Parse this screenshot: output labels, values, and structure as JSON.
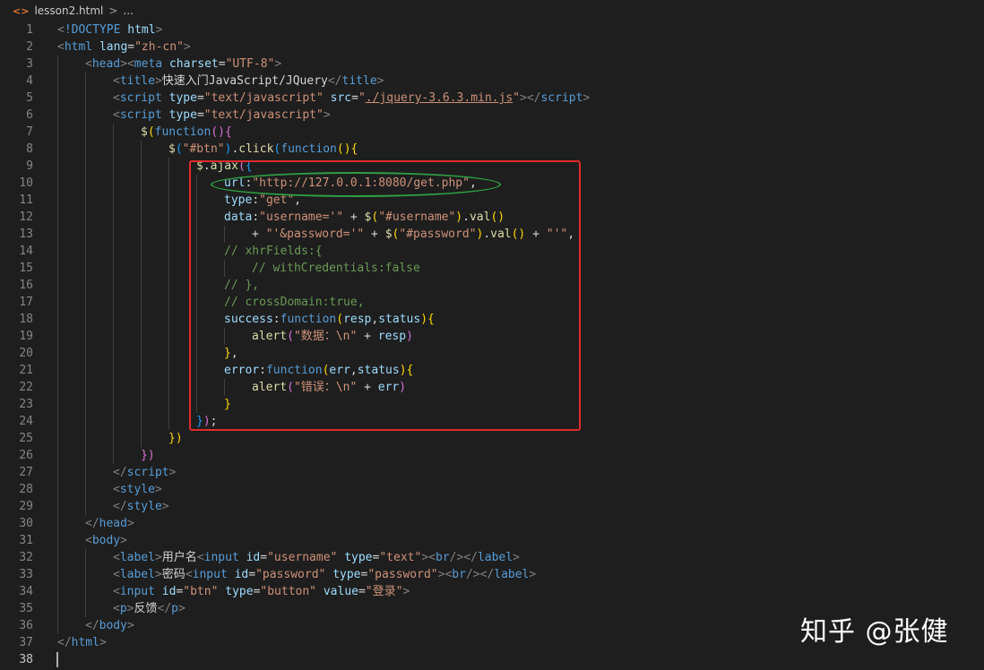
{
  "breadcrumb": {
    "icon": "html-file-icon",
    "file": "lesson2.html",
    "separator": ">",
    "symbol": "..."
  },
  "annotations": {
    "red_box": "highlight-ajax-block",
    "green_ellipse": "highlight-url-line"
  },
  "watermark": "知乎 @张健",
  "colors": {
    "background": "#1e1e1e",
    "red_box": "#e02b2b",
    "green_ellipse": "#2ea043",
    "line_number": "#858585"
  },
  "code_lines": [
    {
      "n": "1",
      "indent": 0,
      "tokens": [
        {
          "t": "<",
          "c": "br"
        },
        {
          "t": "!DOCTYPE",
          "c": "tag"
        },
        {
          "t": " html",
          "c": "attr"
        },
        {
          "t": ">",
          "c": "br"
        }
      ]
    },
    {
      "n": "2",
      "indent": 0,
      "tokens": [
        {
          "t": "<",
          "c": "br"
        },
        {
          "t": "html",
          "c": "tag"
        },
        {
          "t": " lang",
          "c": "attr"
        },
        {
          "t": "=",
          "c": "txt"
        },
        {
          "t": "\"zh-cn\"",
          "c": "str"
        },
        {
          "t": ">",
          "c": "br"
        }
      ]
    },
    {
      "n": "3",
      "indent": 1,
      "tokens": [
        {
          "t": "<",
          "c": "br"
        },
        {
          "t": "head",
          "c": "tag"
        },
        {
          "t": "><",
          "c": "br"
        },
        {
          "t": "meta",
          "c": "tag"
        },
        {
          "t": " charset",
          "c": "attr"
        },
        {
          "t": "=",
          "c": "txt"
        },
        {
          "t": "\"UTF-8\"",
          "c": "str"
        },
        {
          "t": ">",
          "c": "br"
        }
      ]
    },
    {
      "n": "4",
      "indent": 2,
      "tokens": [
        {
          "t": "<",
          "c": "br"
        },
        {
          "t": "title",
          "c": "tag"
        },
        {
          "t": ">",
          "c": "br"
        },
        {
          "t": "快速入门JavaScript/JQuery",
          "c": "txt"
        },
        {
          "t": "</",
          "c": "br"
        },
        {
          "t": "title",
          "c": "tag"
        },
        {
          "t": ">",
          "c": "br"
        }
      ]
    },
    {
      "n": "5",
      "indent": 2,
      "tokens": [
        {
          "t": "<",
          "c": "br"
        },
        {
          "t": "script",
          "c": "tag"
        },
        {
          "t": " type",
          "c": "attr"
        },
        {
          "t": "=",
          "c": "txt"
        },
        {
          "t": "\"text/javascript\"",
          "c": "str"
        },
        {
          "t": " src",
          "c": "attr"
        },
        {
          "t": "=",
          "c": "txt"
        },
        {
          "t": "\"",
          "c": "str"
        },
        {
          "t": "./jquery-3.6.3.min.js",
          "c": "link"
        },
        {
          "t": "\"",
          "c": "str"
        },
        {
          "t": "></",
          "c": "br"
        },
        {
          "t": "script",
          "c": "tag"
        },
        {
          "t": ">",
          "c": "br"
        }
      ]
    },
    {
      "n": "6",
      "indent": 2,
      "tokens": [
        {
          "t": "<",
          "c": "br"
        },
        {
          "t": "script",
          "c": "tag"
        },
        {
          "t": " type",
          "c": "attr"
        },
        {
          "t": "=",
          "c": "txt"
        },
        {
          "t": "\"text/javascript\"",
          "c": "str"
        },
        {
          "t": ">",
          "c": "br"
        }
      ]
    },
    {
      "n": "7",
      "indent": 3,
      "tokens": [
        {
          "t": "$",
          "c": "fn"
        },
        {
          "t": "(",
          "c": "b1"
        },
        {
          "t": "function",
          "c": "kw"
        },
        {
          "t": "()",
          "c": "b2"
        },
        {
          "t": "{",
          "c": "b2"
        }
      ]
    },
    {
      "n": "8",
      "indent": 4,
      "tokens": [
        {
          "t": "$",
          "c": "fn"
        },
        {
          "t": "(",
          "c": "b3"
        },
        {
          "t": "\"#btn\"",
          "c": "str"
        },
        {
          "t": ")",
          "c": "b3"
        },
        {
          "t": ".",
          "c": "txt"
        },
        {
          "t": "click",
          "c": "fn"
        },
        {
          "t": "(",
          "c": "b3"
        },
        {
          "t": "function",
          "c": "kw"
        },
        {
          "t": "()",
          "c": "b1"
        },
        {
          "t": "{",
          "c": "b1"
        }
      ]
    },
    {
      "n": "9",
      "indent": 5,
      "tokens": [
        {
          "t": "$",
          "c": "fn"
        },
        {
          "t": ".",
          "c": "txt"
        },
        {
          "t": "ajax",
          "c": "fn"
        },
        {
          "t": "(",
          "c": "b2"
        },
        {
          "t": "{",
          "c": "b3"
        }
      ]
    },
    {
      "n": "10",
      "indent": 6,
      "tokens": [
        {
          "t": "url",
          "c": "attr"
        },
        {
          "t": ":",
          "c": "txt"
        },
        {
          "t": "\"http://127.0.0.1:8080/get.php\"",
          "c": "str"
        },
        {
          "t": ",",
          "c": "txt"
        }
      ]
    },
    {
      "n": "11",
      "indent": 6,
      "tokens": [
        {
          "t": "type",
          "c": "attr"
        },
        {
          "t": ":",
          "c": "txt"
        },
        {
          "t": "\"get\"",
          "c": "str"
        },
        {
          "t": ",",
          "c": "txt"
        }
      ]
    },
    {
      "n": "12",
      "indent": 6,
      "tokens": [
        {
          "t": "data",
          "c": "attr"
        },
        {
          "t": ":",
          "c": "txt"
        },
        {
          "t": "\"username='\"",
          "c": "str"
        },
        {
          "t": " + ",
          "c": "txt"
        },
        {
          "t": "$",
          "c": "fn"
        },
        {
          "t": "(",
          "c": "b1"
        },
        {
          "t": "\"#username\"",
          "c": "str"
        },
        {
          "t": ")",
          "c": "b1"
        },
        {
          "t": ".",
          "c": "txt"
        },
        {
          "t": "val",
          "c": "fn"
        },
        {
          "t": "()",
          "c": "b1"
        }
      ]
    },
    {
      "n": "13",
      "indent": 7,
      "tokens": [
        {
          "t": "+ ",
          "c": "txt"
        },
        {
          "t": "\"'&password='\"",
          "c": "str"
        },
        {
          "t": " + ",
          "c": "txt"
        },
        {
          "t": "$",
          "c": "fn"
        },
        {
          "t": "(",
          "c": "b1"
        },
        {
          "t": "\"#password\"",
          "c": "str"
        },
        {
          "t": ")",
          "c": "b1"
        },
        {
          "t": ".",
          "c": "txt"
        },
        {
          "t": "val",
          "c": "fn"
        },
        {
          "t": "()",
          "c": "b1"
        },
        {
          "t": " + ",
          "c": "txt"
        },
        {
          "t": "\"'\"",
          "c": "str"
        },
        {
          "t": ",",
          "c": "txt"
        }
      ]
    },
    {
      "n": "14",
      "indent": 6,
      "tokens": [
        {
          "t": "// xhrFields:{",
          "c": "com"
        }
      ]
    },
    {
      "n": "15",
      "indent": 7,
      "tokens": [
        {
          "t": "// withCredentials:false",
          "c": "com"
        }
      ]
    },
    {
      "n": "16",
      "indent": 6,
      "tokens": [
        {
          "t": "// },",
          "c": "com"
        }
      ]
    },
    {
      "n": "17",
      "indent": 6,
      "tokens": [
        {
          "t": "// crossDomain:true,",
          "c": "com"
        }
      ]
    },
    {
      "n": "18",
      "indent": 6,
      "tokens": [
        {
          "t": "success",
          "c": "attr"
        },
        {
          "t": ":",
          "c": "txt"
        },
        {
          "t": "function",
          "c": "kw"
        },
        {
          "t": "(",
          "c": "b1"
        },
        {
          "t": "resp",
          "c": "attr"
        },
        {
          "t": ",",
          "c": "txt"
        },
        {
          "t": "status",
          "c": "attr"
        },
        {
          "t": ")",
          "c": "b1"
        },
        {
          "t": "{",
          "c": "b1"
        }
      ]
    },
    {
      "n": "19",
      "indent": 7,
      "tokens": [
        {
          "t": "alert",
          "c": "fn"
        },
        {
          "t": "(",
          "c": "b2"
        },
        {
          "t": "\"数据：\\n\"",
          "c": "str"
        },
        {
          "t": " + ",
          "c": "txt"
        },
        {
          "t": "resp",
          "c": "attr"
        },
        {
          "t": ")",
          "c": "b2"
        }
      ]
    },
    {
      "n": "20",
      "indent": 6,
      "tokens": [
        {
          "t": "}",
          "c": "b1"
        },
        {
          "t": ",",
          "c": "txt"
        }
      ]
    },
    {
      "n": "21",
      "indent": 6,
      "tokens": [
        {
          "t": "error",
          "c": "attr"
        },
        {
          "t": ":",
          "c": "txt"
        },
        {
          "t": "function",
          "c": "kw"
        },
        {
          "t": "(",
          "c": "b1"
        },
        {
          "t": "err",
          "c": "attr"
        },
        {
          "t": ",",
          "c": "txt"
        },
        {
          "t": "status",
          "c": "attr"
        },
        {
          "t": ")",
          "c": "b1"
        },
        {
          "t": "{",
          "c": "b1"
        }
      ]
    },
    {
      "n": "22",
      "indent": 7,
      "tokens": [
        {
          "t": "alert",
          "c": "fn"
        },
        {
          "t": "(",
          "c": "b2"
        },
        {
          "t": "\"错误：\\n\"",
          "c": "str"
        },
        {
          "t": " + ",
          "c": "txt"
        },
        {
          "t": "err",
          "c": "attr"
        },
        {
          "t": ")",
          "c": "b2"
        }
      ]
    },
    {
      "n": "23",
      "indent": 6,
      "tokens": [
        {
          "t": "}",
          "c": "b1"
        }
      ]
    },
    {
      "n": "24",
      "indent": 5,
      "tokens": [
        {
          "t": "}",
          "c": "b3"
        },
        {
          "t": ")",
          "c": "b2"
        },
        {
          "t": ";",
          "c": "txt"
        }
      ]
    },
    {
      "n": "25",
      "indent": 4,
      "tokens": [
        {
          "t": "})",
          "c": "b1"
        }
      ]
    },
    {
      "n": "26",
      "indent": 3,
      "tokens": [
        {
          "t": "})",
          "c": "b2"
        }
      ]
    },
    {
      "n": "27",
      "indent": 2,
      "tokens": [
        {
          "t": "</",
          "c": "br"
        },
        {
          "t": "script",
          "c": "tag"
        },
        {
          "t": ">",
          "c": "br"
        }
      ]
    },
    {
      "n": "28",
      "indent": 2,
      "tokens": [
        {
          "t": "<",
          "c": "br"
        },
        {
          "t": "style",
          "c": "tag"
        },
        {
          "t": ">",
          "c": "br"
        }
      ]
    },
    {
      "n": "29",
      "indent": 2,
      "tokens": [
        {
          "t": "</",
          "c": "br"
        },
        {
          "t": "style",
          "c": "tag"
        },
        {
          "t": ">",
          "c": "br"
        }
      ]
    },
    {
      "n": "30",
      "indent": 1,
      "tokens": [
        {
          "t": "</",
          "c": "br"
        },
        {
          "t": "head",
          "c": "tag"
        },
        {
          "t": ">",
          "c": "br"
        }
      ]
    },
    {
      "n": "31",
      "indent": 1,
      "tokens": [
        {
          "t": "<",
          "c": "br"
        },
        {
          "t": "body",
          "c": "tag"
        },
        {
          "t": ">",
          "c": "br"
        }
      ]
    },
    {
      "n": "32",
      "indent": 2,
      "tokens": [
        {
          "t": "<",
          "c": "br"
        },
        {
          "t": "label",
          "c": "tag"
        },
        {
          "t": ">",
          "c": "br"
        },
        {
          "t": "用户名",
          "c": "txt"
        },
        {
          "t": "<",
          "c": "br"
        },
        {
          "t": "input",
          "c": "tag"
        },
        {
          "t": " id",
          "c": "attr"
        },
        {
          "t": "=",
          "c": "txt"
        },
        {
          "t": "\"username\"",
          "c": "str"
        },
        {
          "t": " type",
          "c": "attr"
        },
        {
          "t": "=",
          "c": "txt"
        },
        {
          "t": "\"text\"",
          "c": "str"
        },
        {
          "t": "><",
          "c": "br"
        },
        {
          "t": "br",
          "c": "tag"
        },
        {
          "t": "/></",
          "c": "br"
        },
        {
          "t": "label",
          "c": "tag"
        },
        {
          "t": ">",
          "c": "br"
        }
      ]
    },
    {
      "n": "33",
      "indent": 2,
      "tokens": [
        {
          "t": "<",
          "c": "br"
        },
        {
          "t": "label",
          "c": "tag"
        },
        {
          "t": ">",
          "c": "br"
        },
        {
          "t": "密码",
          "c": "txt"
        },
        {
          "t": "<",
          "c": "br"
        },
        {
          "t": "input",
          "c": "tag"
        },
        {
          "t": " id",
          "c": "attr"
        },
        {
          "t": "=",
          "c": "txt"
        },
        {
          "t": "\"password\"",
          "c": "str"
        },
        {
          "t": " type",
          "c": "attr"
        },
        {
          "t": "=",
          "c": "txt"
        },
        {
          "t": "\"password\"",
          "c": "str"
        },
        {
          "t": "><",
          "c": "br"
        },
        {
          "t": "br",
          "c": "tag"
        },
        {
          "t": "/></",
          "c": "br"
        },
        {
          "t": "label",
          "c": "tag"
        },
        {
          "t": ">",
          "c": "br"
        }
      ]
    },
    {
      "n": "34",
      "indent": 2,
      "tokens": [
        {
          "t": "<",
          "c": "br"
        },
        {
          "t": "input",
          "c": "tag"
        },
        {
          "t": " id",
          "c": "attr"
        },
        {
          "t": "=",
          "c": "txt"
        },
        {
          "t": "\"btn\"",
          "c": "str"
        },
        {
          "t": " type",
          "c": "attr"
        },
        {
          "t": "=",
          "c": "txt"
        },
        {
          "t": "\"button\"",
          "c": "str"
        },
        {
          "t": " value",
          "c": "attr"
        },
        {
          "t": "=",
          "c": "txt"
        },
        {
          "t": "\"登录\"",
          "c": "str"
        },
        {
          "t": ">",
          "c": "br"
        }
      ]
    },
    {
      "n": "35",
      "indent": 2,
      "tokens": [
        {
          "t": "<",
          "c": "br"
        },
        {
          "t": "p",
          "c": "tag"
        },
        {
          "t": ">",
          "c": "br"
        },
        {
          "t": "反馈",
          "c": "txt"
        },
        {
          "t": "</",
          "c": "br"
        },
        {
          "t": "p",
          "c": "tag"
        },
        {
          "t": ">",
          "c": "br"
        }
      ]
    },
    {
      "n": "36",
      "indent": 1,
      "tokens": [
        {
          "t": "</",
          "c": "br"
        },
        {
          "t": "body",
          "c": "tag"
        },
        {
          "t": ">",
          "c": "br"
        }
      ]
    },
    {
      "n": "37",
      "indent": 0,
      "tokens": [
        {
          "t": "</",
          "c": "br"
        },
        {
          "t": "html",
          "c": "tag"
        },
        {
          "t": ">",
          "c": "br"
        }
      ]
    },
    {
      "n": "38",
      "indent": 0,
      "tokens": [],
      "current": true
    }
  ]
}
